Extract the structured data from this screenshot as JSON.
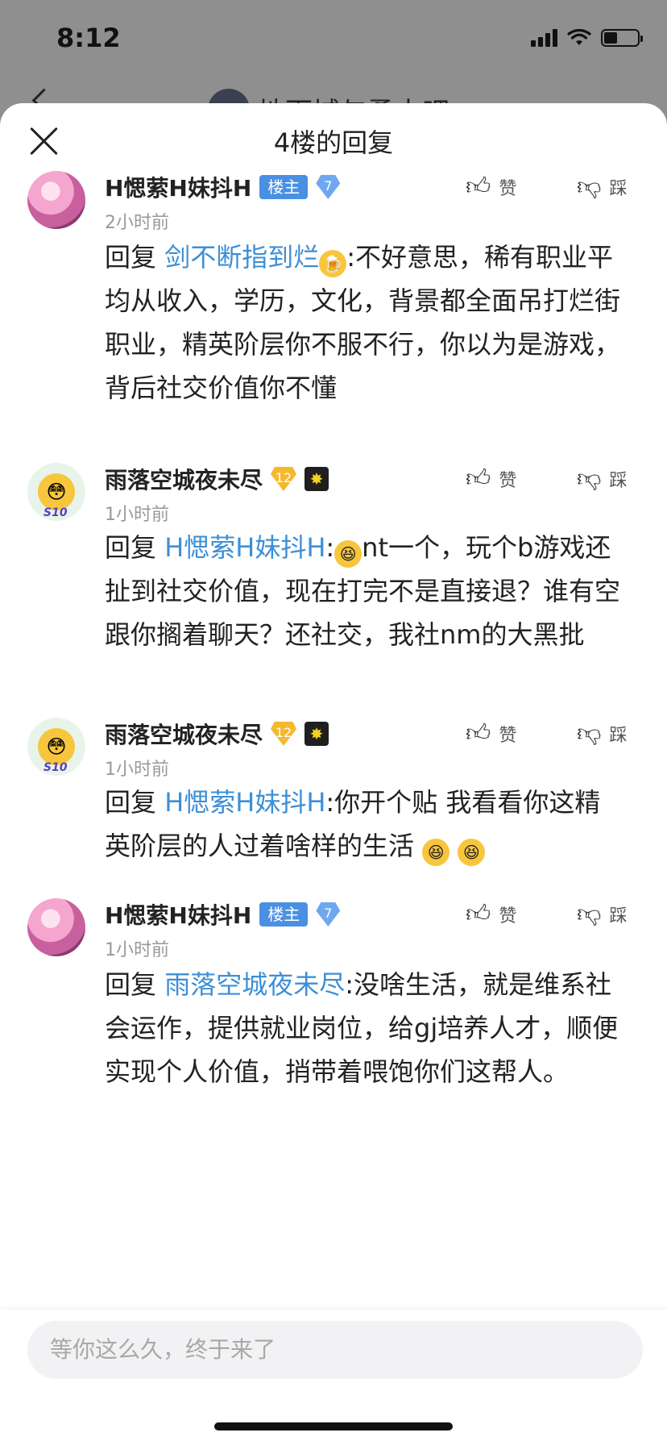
{
  "status_bar": {
    "time": "8:12"
  },
  "background_header": {
    "title": "地下城与勇士吧"
  },
  "sheet": {
    "title": "4楼的回复"
  },
  "replies": [
    {
      "username": "H愢萦H妹抖H",
      "owner_badge": "楼主",
      "level": "7",
      "time": "2小时前",
      "like_label": "赞",
      "dislike_label": "踩",
      "prefix": "回复",
      "mention": "剑不断指到烂",
      "text": ":不好意思，稀有职业平均从收入，学历，文化，背景都全面吊打烂街职业，精英阶层你不服不行，你以为是游戏，背后社交价值你不懂"
    },
    {
      "username": "雨落空城夜未尽",
      "level": "12",
      "avatar_tag": "S10",
      "time": "1小时前",
      "like_label": "赞",
      "dislike_label": "踩",
      "prefix": "回复",
      "mention": "H愢萦H妹抖H",
      "text_a": ":",
      "text": "nt一个，玩个b游戏还扯到社交价值，现在打完不是直接退？谁有空跟你搁着聊天？还社交，我社nm的大黑批"
    },
    {
      "username": "雨落空城夜未尽",
      "level": "12",
      "avatar_tag": "S10",
      "time": "1小时前",
      "like_label": "赞",
      "dislike_label": "踩",
      "prefix": "回复",
      "mention": "H愢萦H妹抖H",
      "text": ":你开个贴 我看看你这精英阶层的人过着啥样的生活"
    },
    {
      "username": "H愢萦H妹抖H",
      "owner_badge": "楼主",
      "level": "7",
      "time": "1小时前",
      "like_label": "赞",
      "dislike_label": "踩",
      "prefix": "回复",
      "mention": "雨落空城夜未尽",
      "text": ":没啥生活，就是维系社会运作，提供就业岗位，给gj培养人才，顺便实现个人价值，捎带着喂饱你们这帮人。"
    }
  ],
  "input": {
    "placeholder": "等你这么久，终于来了"
  },
  "colors": {
    "mention": "#3d8fd6",
    "owner_badge": "#4a90e2",
    "level_gold": "#f5b82e",
    "gem_blue": "#6fa8ee"
  },
  "icons": {
    "like": "thumbs-up-icon",
    "dislike": "thumbs-down-icon",
    "close": "close-icon"
  }
}
